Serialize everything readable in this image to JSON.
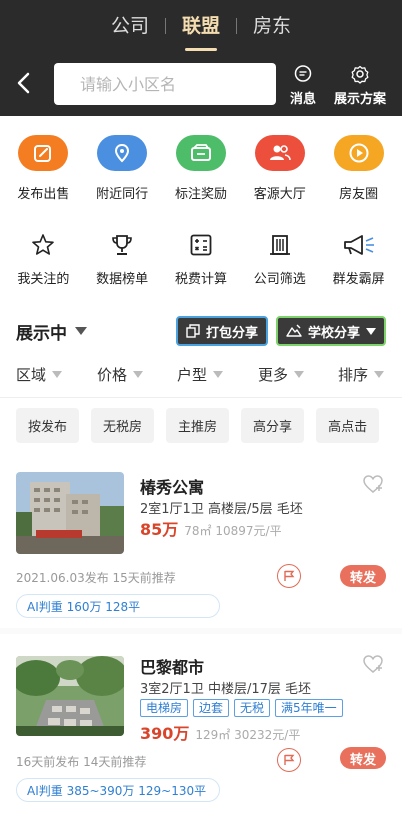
{
  "top_tabs": [
    "公司",
    "联盟",
    "房东"
  ],
  "search": {
    "placeholder": "请输入小区名"
  },
  "header_actions": {
    "message": "消息",
    "display_plan": "展示方案"
  },
  "quick_actions": [
    {
      "label": "发布出售",
      "icon": "edit-icon",
      "color": "#f47d22"
    },
    {
      "label": "附近同行",
      "icon": "location-icon",
      "color": "#4a8fe0"
    },
    {
      "label": "标注奖励",
      "icon": "wallet-icon",
      "color": "#4dbd6a"
    },
    {
      "label": "客源大厅",
      "icon": "people-icon",
      "color": "#ec4f3c"
    },
    {
      "label": "房友圈",
      "icon": "play-icon",
      "color": "#f5a623"
    }
  ],
  "tools": [
    {
      "label": "我关注的",
      "icon": "star-icon"
    },
    {
      "label": "数据榜单",
      "icon": "trophy-icon"
    },
    {
      "label": "税费计算",
      "icon": "calculator-icon"
    },
    {
      "label": "公司筛选",
      "icon": "building-icon"
    },
    {
      "label": "群发霸屏",
      "icon": "megaphone-icon"
    }
  ],
  "display": {
    "title": "展示中",
    "pack_share": "打包分享",
    "school_share": "学校分享"
  },
  "filters": [
    "区域",
    "价格",
    "户型",
    "更多",
    "排序"
  ],
  "quick_tags": [
    "按发布",
    "无税房",
    "主推房",
    "高分享",
    "高点击"
  ],
  "listings": [
    {
      "title": "椿秀公寓",
      "info": "2室1厅1卫  高楼层/5层  毛坯",
      "price": "85万",
      "area_unit": "78㎡  10897元/平",
      "tags": [],
      "date": "2021.06.03发布  15天前推荐",
      "forward": "转发",
      "ai": "AI判重 160万 128平"
    },
    {
      "title": "巴黎都市",
      "info": "3室2厅1卫  中楼层/17层  毛坯",
      "price": "390万",
      "area_unit": "129㎡  30232元/平",
      "tags": [
        "电梯房",
        "边套",
        "无税",
        "满5年唯一"
      ],
      "date": "16天前发布  14天前推荐",
      "forward": "转发",
      "ai": "AI判重 385~390万 129~130平"
    }
  ]
}
